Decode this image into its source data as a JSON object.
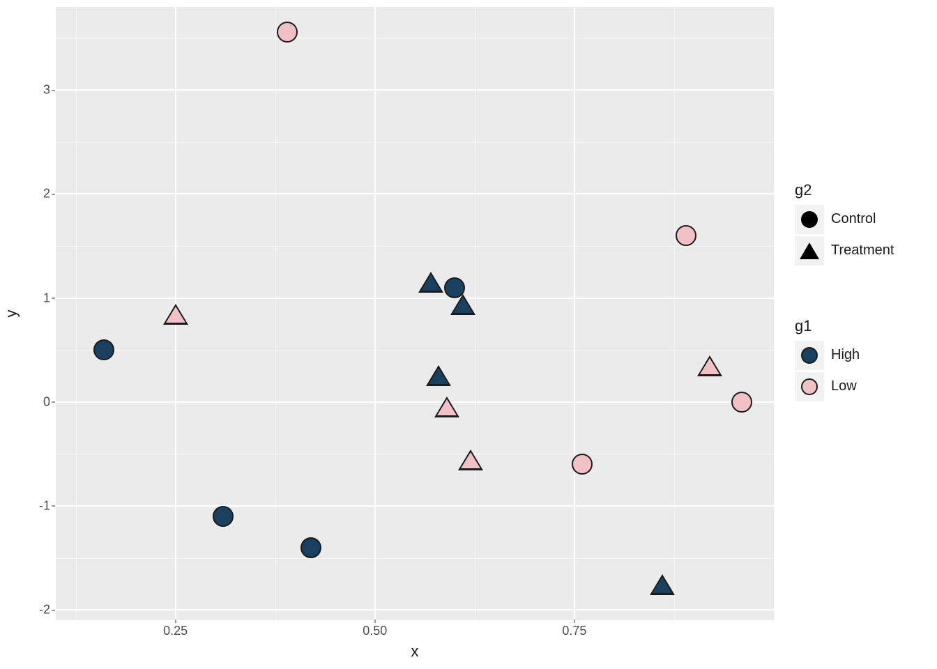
{
  "chart_data": {
    "type": "scatter",
    "xlabel": "x",
    "ylabel": "y",
    "xlim": [
      0.1,
      1.0
    ],
    "ylim": [
      -2.1,
      3.8
    ],
    "x_ticks": [
      0.25,
      0.5,
      0.75
    ],
    "y_ticks": [
      -2,
      -1,
      0,
      1,
      2,
      3
    ],
    "colors": {
      "High": "#19415F",
      "Low": "#F1C1C5"
    },
    "shapes": {
      "Control": "circle",
      "Treatment": "triangle"
    },
    "legends": {
      "g2": {
        "title": "g2",
        "items": [
          "Control",
          "Treatment"
        ]
      },
      "g1": {
        "title": "g1",
        "items": [
          "High",
          "Low"
        ]
      }
    },
    "points": [
      {
        "x": 0.16,
        "y": 0.5,
        "g1": "High",
        "g2": "Control"
      },
      {
        "x": 0.31,
        "y": -1.1,
        "g1": "High",
        "g2": "Control"
      },
      {
        "x": 0.42,
        "y": -1.4,
        "g1": "High",
        "g2": "Control"
      },
      {
        "x": 0.6,
        "y": 1.1,
        "g1": "High",
        "g2": "Control"
      },
      {
        "x": 0.57,
        "y": 1.13,
        "g1": "High",
        "g2": "Treatment"
      },
      {
        "x": 0.61,
        "y": 0.92,
        "g1": "High",
        "g2": "Treatment"
      },
      {
        "x": 0.58,
        "y": 0.23,
        "g1": "High",
        "g2": "Treatment"
      },
      {
        "x": 0.86,
        "y": -1.78,
        "g1": "High",
        "g2": "Treatment"
      },
      {
        "x": 0.39,
        "y": 3.56,
        "g1": "Low",
        "g2": "Control"
      },
      {
        "x": 0.76,
        "y": -0.6,
        "g1": "Low",
        "g2": "Control"
      },
      {
        "x": 0.89,
        "y": 1.6,
        "g1": "Low",
        "g2": "Control"
      },
      {
        "x": 0.96,
        "y": 0.0,
        "g1": "Low",
        "g2": "Control"
      },
      {
        "x": 0.25,
        "y": 0.82,
        "g1": "Low",
        "g2": "Treatment"
      },
      {
        "x": 0.59,
        "y": -0.07,
        "g1": "Low",
        "g2": "Treatment"
      },
      {
        "x": 0.62,
        "y": -0.58,
        "g1": "Low",
        "g2": "Treatment"
      },
      {
        "x": 0.92,
        "y": 0.33,
        "g1": "Low",
        "g2": "Treatment"
      }
    ]
  },
  "x_tick_labels": {
    "t0": "0.25",
    "t1": "0.50",
    "t2": "0.75"
  },
  "y_tick_labels": {
    "t0": "-2",
    "t1": "-1",
    "t2": "0",
    "t3": "1",
    "t4": "2",
    "t5": "3"
  }
}
